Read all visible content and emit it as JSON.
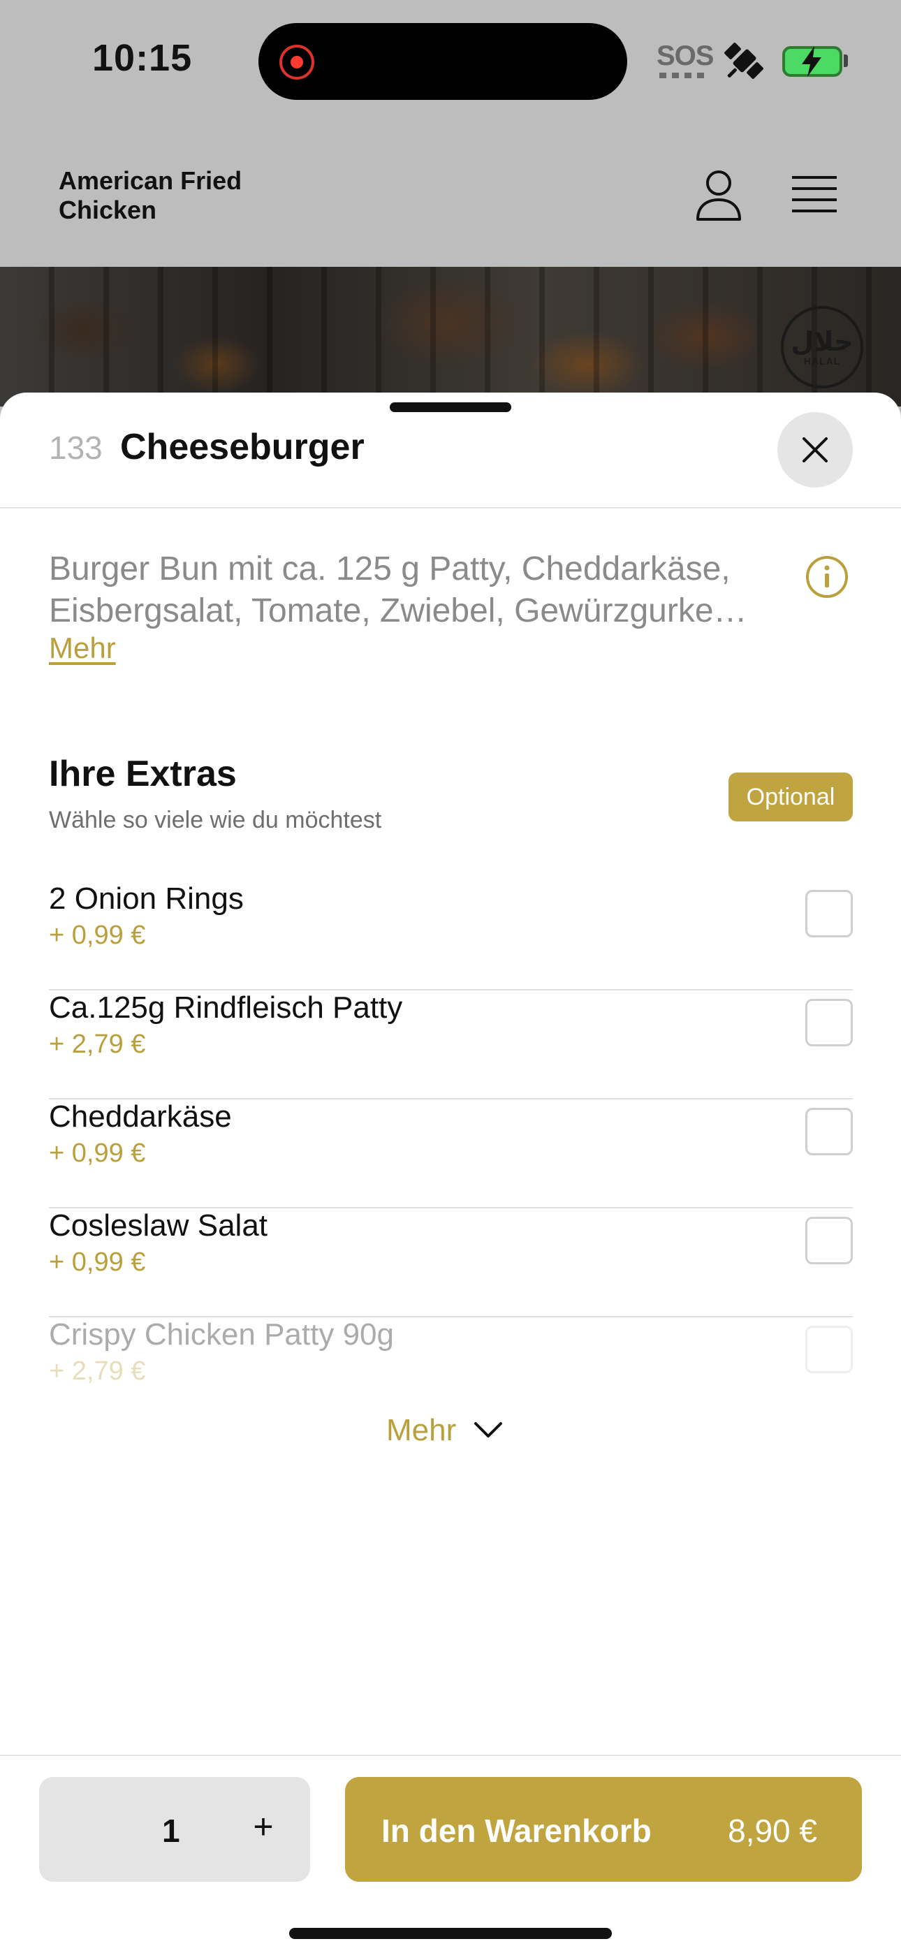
{
  "status_bar": {
    "time": "10:15",
    "sos": "SOS"
  },
  "header": {
    "brand": "American Fried Chicken"
  },
  "hero": {
    "halal_arabic": "حلال",
    "halal_label": "HALAL"
  },
  "product": {
    "number": "133",
    "title": "Cheeseburger",
    "description_line1": "Burger Bun mit ca. 125 g Patty, Cheddarkäse,",
    "description_line2": "Eisbergsalat, Tomate, Zwiebel, Gewürzgurke…",
    "more_link": "Mehr"
  },
  "extras": {
    "title": "Ihre Extras",
    "subtitle": "Wähle so viele wie du möchtest",
    "badge": "Optional",
    "items": [
      {
        "name": "2 Onion Rings",
        "price": "+ 0,99 €"
      },
      {
        "name": "Ca.125g Rindfleisch Patty",
        "price": "+ 2,79 €"
      },
      {
        "name": "Cheddarkäse",
        "price": "+ 0,99 €"
      },
      {
        "name": "Cosleslaw Salat",
        "price": "+ 0,99 €"
      },
      {
        "name": "Crispy Chicken Patty 90g",
        "price": "+ 2,79 €"
      }
    ],
    "more_label": "Mehr"
  },
  "footer": {
    "quantity": "1",
    "plus_label": "+",
    "cart_label": "In den Warenkorb",
    "cart_price": "8,90 €"
  },
  "colors": {
    "accent": "#c0a43f",
    "header_bg": "#bdbdbd"
  }
}
